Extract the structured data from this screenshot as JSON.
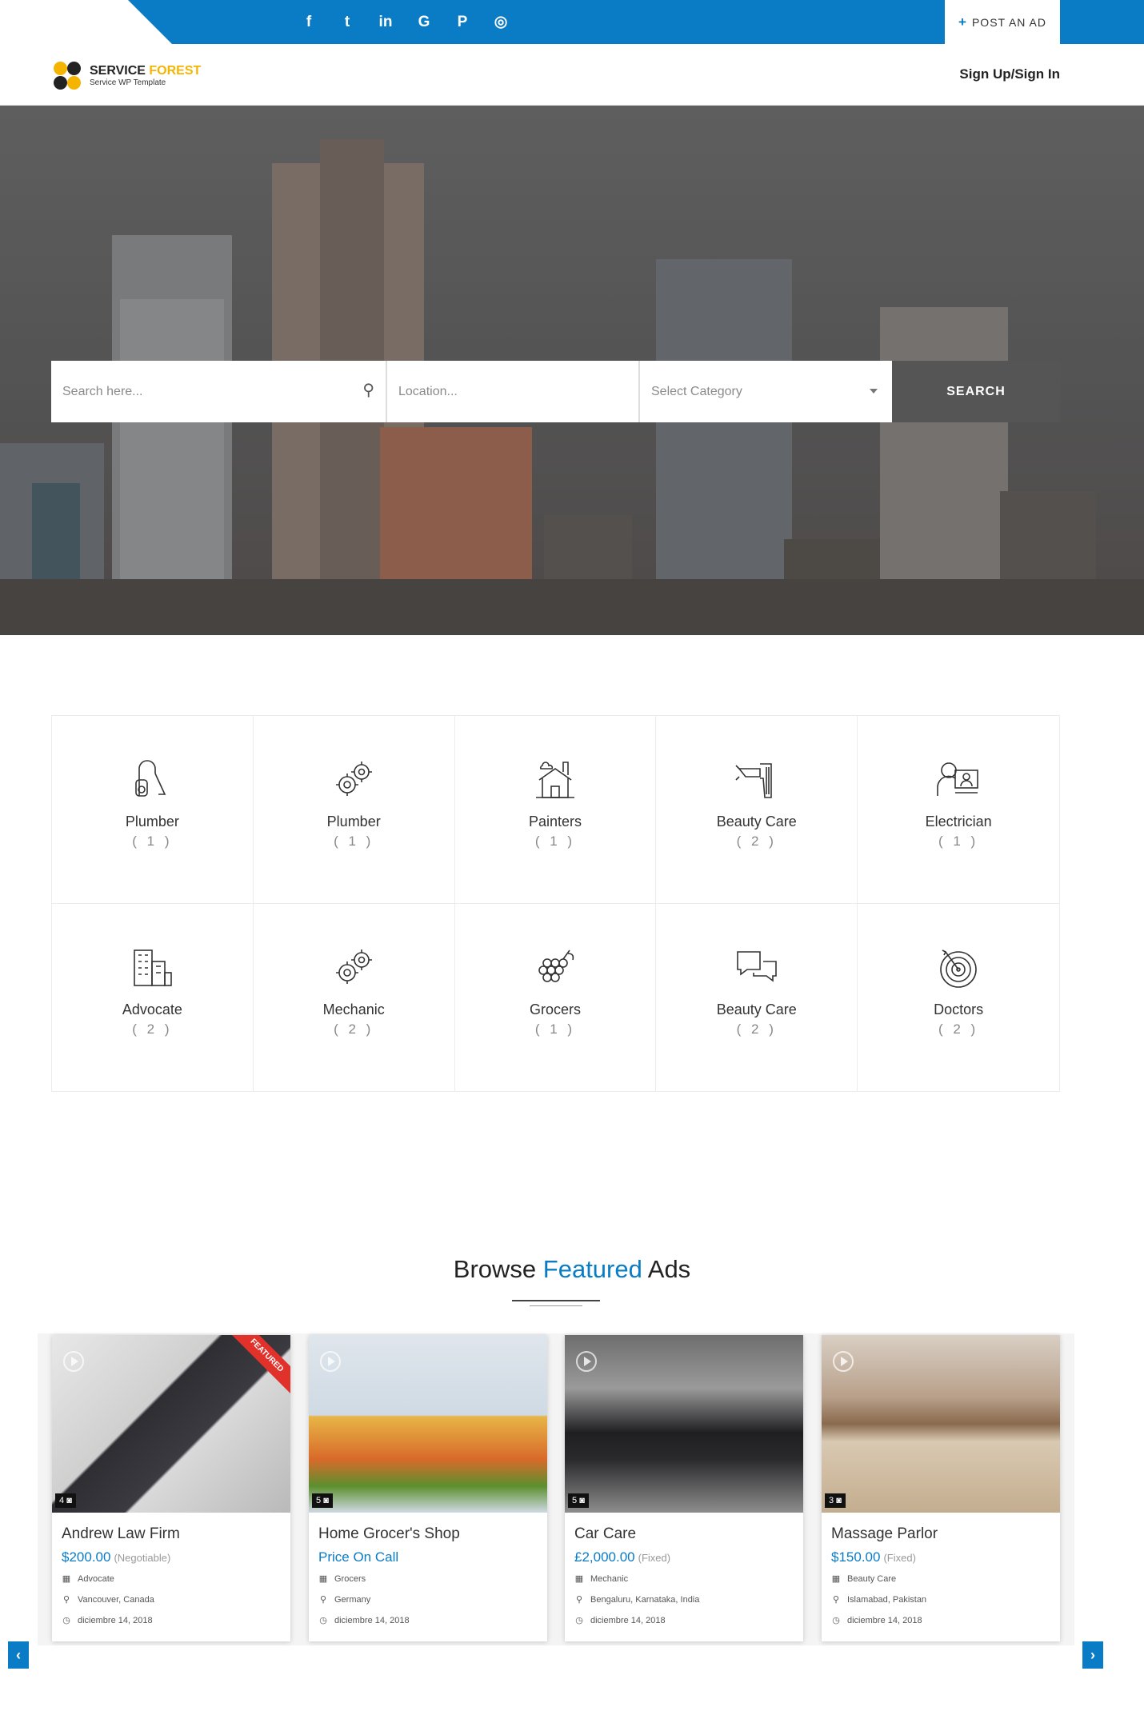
{
  "topbar": {
    "social": [
      {
        "icon": "facebook-icon",
        "glyph": "f"
      },
      {
        "icon": "twitter-icon",
        "glyph": "t"
      },
      {
        "icon": "linkedin-icon",
        "glyph": "in"
      },
      {
        "icon": "google-icon",
        "glyph": "G"
      },
      {
        "icon": "pinterest-icon",
        "glyph": "P"
      },
      {
        "icon": "instagram-icon",
        "glyph": "◎"
      }
    ],
    "post_ad_label": "POST AN AD"
  },
  "header": {
    "logo_title_a": "SERVICE ",
    "logo_title_b": "FOREST",
    "logo_subtitle": "Service WP Template",
    "signin_label": "Sign Up/Sign In"
  },
  "search": {
    "keyword_placeholder": "Search here...",
    "location_placeholder": "Location...",
    "category_selected": "Select Category",
    "button_label": "SEARCH"
  },
  "categories": [
    {
      "name": "Plumber",
      "count": "( 1 )",
      "icon": "vacuum-icon"
    },
    {
      "name": "Plumber",
      "count": "( 1 )",
      "icon": "gears-icon"
    },
    {
      "name": "Painters",
      "count": "( 1 )",
      "icon": "house-icon"
    },
    {
      "name": "Beauty Care",
      "count": "( 2 )",
      "icon": "paint-gun-icon"
    },
    {
      "name": "Electrician",
      "count": "( 1 )",
      "icon": "user-monitor-icon"
    },
    {
      "name": "Advocate",
      "count": "( 2 )",
      "icon": "buildings-icon"
    },
    {
      "name": "Mechanic",
      "count": "( 2 )",
      "icon": "gears-icon"
    },
    {
      "name": "Grocers",
      "count": "( 1 )",
      "icon": "grapes-icon"
    },
    {
      "name": "Beauty Care",
      "count": "( 2 )",
      "icon": "chat-bubbles-icon"
    },
    {
      "name": "Doctors",
      "count": "( 2 )",
      "icon": "target-icon"
    }
  ],
  "featured": {
    "title_a": "Browse ",
    "title_b": "Featured",
    "title_c": " Ads",
    "ribbon_label": "FEATURED",
    "ads": [
      {
        "title": "Andrew Law Firm",
        "price": "$200.00",
        "price_note": "(Negotiable)",
        "category": "Advocate",
        "location": "Vancouver, Canada",
        "date": "diciembre 14, 2018",
        "photos": "4",
        "featured": true
      },
      {
        "title": "Home Grocer's Shop",
        "price": "Price On Call",
        "price_note": "",
        "category": "Grocers",
        "location": "Germany",
        "date": "diciembre 14, 2018",
        "photos": "5",
        "featured": false
      },
      {
        "title": "Car Care",
        "price": "£2,000.00",
        "price_note": "(Fixed)",
        "category": "Mechanic",
        "location": "Bengaluru, Karnataka, India",
        "date": "diciembre 14, 2018",
        "photos": "5",
        "featured": false
      },
      {
        "title": "Massage Parlor",
        "price": "$150.00",
        "price_note": "(Fixed)",
        "category": "Beauty Care",
        "location": "Islamabad, Pakistan",
        "date": "diciembre 14, 2018",
        "photos": "3",
        "featured": false
      }
    ]
  },
  "colors": {
    "accent": "#0a7bc5",
    "ribbon": "#e0322b",
    "brand_yellow": "#f5b400"
  }
}
